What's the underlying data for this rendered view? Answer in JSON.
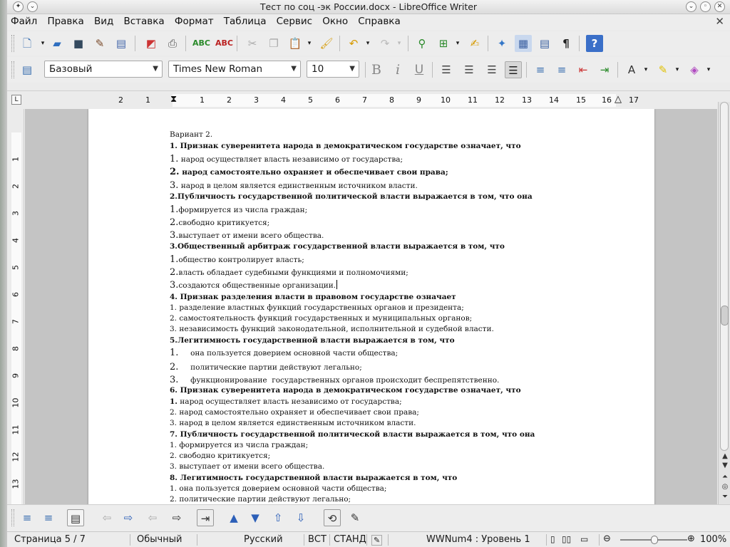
{
  "window": {
    "title": "Тест по соц -эк России.docx - LibreOffice Writer"
  },
  "menu": [
    "Файл",
    "Правка",
    "Вид",
    "Вставка",
    "Формат",
    "Таблица",
    "Сервис",
    "Окно",
    "Справка"
  ],
  "formatting": {
    "paragraph_style": "Базовый",
    "font_name": "Times New Roman",
    "font_size": "10"
  },
  "ruler": {
    "h_ticks": [
      "2",
      "1",
      "1",
      "2",
      "3",
      "4",
      "5",
      "6",
      "7",
      "8",
      "9",
      "10",
      "11",
      "12",
      "13",
      "14",
      "15",
      "16",
      "17"
    ],
    "v_ticks": [
      "1",
      "2",
      "3",
      "4",
      "5",
      "6",
      "7",
      "8",
      "9",
      "10",
      "11",
      "12",
      "13"
    ]
  },
  "document": {
    "lines": [
      {
        "num": "",
        "text": "Вариант 2.",
        "bold": false
      },
      {
        "num": "1.",
        "text": " Признак суверенитета народа в демократическом государстве означает, что",
        "bold": true
      },
      {
        "num": "1.",
        "text": " народ осуществляет власть независимо от государства;",
        "bold": false,
        "bignum": true
      },
      {
        "num": "2.",
        "text": " народ самостоятельно охраняет и обеспечивает свои права;",
        "bold": true,
        "bignum": true
      },
      {
        "num": "3.",
        "text": " народ в целом является единственным источником власти.",
        "bold": false,
        "bignum": true
      },
      {
        "num": "2.",
        "text": "Публичность государственной политической власти выражается в том, что она",
        "bold": true
      },
      {
        "num": "1.",
        "text": "формируется из числа граждан;",
        "bold": false,
        "bignum": true
      },
      {
        "num": "2.",
        "text": "свободно критикуется;",
        "bold": false,
        "bignum": true
      },
      {
        "num": "3.",
        "text": "выступает от имени всего общества.",
        "bold": false,
        "bignum": true
      },
      {
        "num": "3.",
        "text": "Общественный арбитраж государственной власти выражается в том, что",
        "bold": true
      },
      {
        "num": "1.",
        "text": "общество контролирует власть;",
        "bold": false,
        "bignum": true
      },
      {
        "num": "2.",
        "text": "власть обладает судебными функциями и полномочиями;",
        "bold": false,
        "bignum": true
      },
      {
        "num": "3.",
        "text": "создаются общественные организации.",
        "bold": false,
        "bignum": true,
        "cursor": true
      },
      {
        "num": "4.",
        "text": " Признак разделения власти в правовом государстве означает",
        "bold": true
      },
      {
        "num": "1.",
        "text": " разделение властных функций государственных органов и президента;",
        "bold": false
      },
      {
        "num": "2.",
        "text": " самостоятельность функций государственных и муниципальных органов;",
        "bold": false
      },
      {
        "num": "3.",
        "text": " независимость функций законодательной, исполнительной и судебной власти.",
        "bold": false
      },
      {
        "num": "5.",
        "text": "Легитимность государственной власти выражается в том, что",
        "bold": true
      },
      {
        "num": "1.",
        "text": "     она пользуется доверием основной части общества;",
        "bold": false,
        "bignum": true
      },
      {
        "num": "2.",
        "text": "     политические партии действуют легально;",
        "bold": false,
        "bignum": true
      },
      {
        "num": "3.",
        "text": "     функционирование  государственных органов происходит беспрепятственно.",
        "bold": false,
        "bignum": true
      },
      {
        "num": "6.",
        "text": " Признак суверенитета народа в демократическом государстве означает, что",
        "bold": true
      },
      {
        "num": "1.",
        "text": " народ осуществляет власть независимо от государства;",
        "bold": false,
        "numbold": true
      },
      {
        "num": "2.",
        "text": " народ самостоятельно охраняет и обеспечивает свои права;",
        "bold": false
      },
      {
        "num": "3.",
        "text": " народ в целом является единственным источником власти.",
        "bold": false
      },
      {
        "num": "7.",
        "text": " Публичность государственной политической власти выражается в том, что она",
        "bold": true
      },
      {
        "num": "1.",
        "text": " формируется из числа граждан;",
        "bold": false
      },
      {
        "num": "2.",
        "text": " свободно критикуется;",
        "bold": false
      },
      {
        "num": "3.",
        "text": " выступает от имени всего общества.",
        "bold": false
      },
      {
        "num": "8.",
        "text": " Легитимность государственной власти выражается в том, что",
        "bold": true
      },
      {
        "num": "1.",
        "text": " она пользуется доверием основной части общества;",
        "bold": false
      },
      {
        "num": "2.",
        "text": " политические партии действуют легально;",
        "bold": false
      }
    ]
  },
  "status": {
    "page": "Страница 5 / 7",
    "page_style": "Обычный",
    "language": "Русский",
    "insert_mode": "ВСТ",
    "selection_mode": "СТАНД",
    "list_level": "WWNum4 : Уровень 1",
    "zoom": "100%"
  }
}
